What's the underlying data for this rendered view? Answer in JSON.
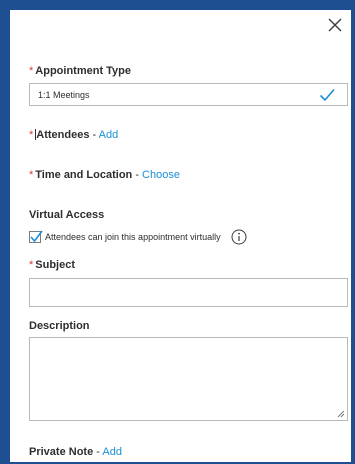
{
  "dialog": {
    "close_icon": "close-icon",
    "colors": {
      "frame": "#1d4f91",
      "required": "#d23b2b",
      "link": "#1b8fd6",
      "check": "#1b8fd6"
    }
  },
  "appointment_type": {
    "required_mark": "*",
    "label": "Appointment Type",
    "value": "1:1 Meetings",
    "status_icon": "checkmark-icon"
  },
  "attendees": {
    "required_mark": "*",
    "label": "Attendees",
    "separator": " - ",
    "action": "Add"
  },
  "time_location": {
    "required_mark": "*",
    "label": "Time and Location",
    "separator": " - ",
    "action": "Choose"
  },
  "virtual_access": {
    "label": "Virtual Access",
    "checkbox_label": "Attendees can join this appointment virtually",
    "checked": true,
    "info_icon": "info-icon"
  },
  "subject": {
    "required_mark": "*",
    "label": "Subject",
    "value": ""
  },
  "description": {
    "label": "Description",
    "value": ""
  },
  "private_note": {
    "label": "Private Note",
    "separator": " - ",
    "action": "Add"
  }
}
